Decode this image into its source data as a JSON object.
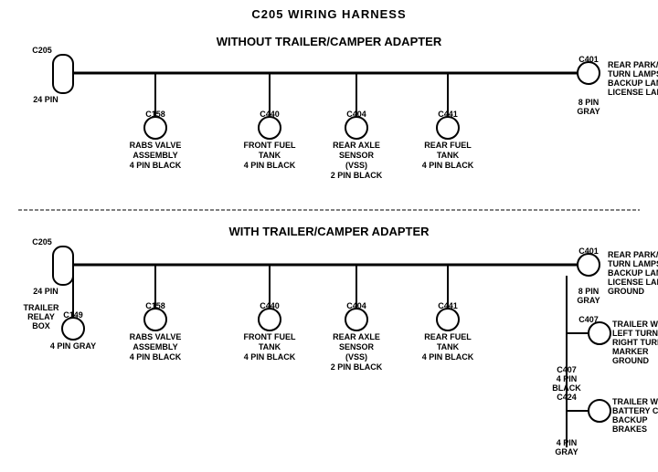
{
  "page": {
    "title": "C205 WIRING HARNESS"
  },
  "top_section": {
    "label": "WITHOUT  TRAILER/CAMPER  ADAPTER",
    "left_connector": {
      "id": "C205",
      "pins": "24 PIN",
      "shape": "rectangle"
    },
    "right_connector": {
      "id": "C401",
      "pins": "8 PIN",
      "color": "GRAY",
      "labels": [
        "REAR PARK/STOP",
        "TURN LAMPS",
        "BACKUP LAMPS",
        "LICENSE LAMPS"
      ]
    },
    "drop_connectors": [
      {
        "id": "C158",
        "label": "RABS VALVE\nASSEMBLY\n4 PIN BLACK"
      },
      {
        "id": "C440",
        "label": "FRONT FUEL\nTANK\n4 PIN BLACK"
      },
      {
        "id": "C404",
        "label": "REAR AXLE\nSENSOR\n(VSS)\n2 PIN BLACK"
      },
      {
        "id": "C441",
        "label": "REAR FUEL\nTANK\n4 PIN BLACK"
      }
    ]
  },
  "bottom_section": {
    "label": "WITH  TRAILER/CAMPER  ADAPTER",
    "left_connector": {
      "id": "C205",
      "pins": "24 PIN",
      "shape": "rectangle"
    },
    "trailer_relay": {
      "label": "TRAILER\nRELAY\nBOX",
      "connector_id": "C149",
      "pins": "4 PIN GRAY"
    },
    "right_connector": {
      "id": "C401",
      "pins": "8 PIN",
      "color": "GRAY",
      "labels": [
        "REAR PARK/STOP",
        "TURN LAMPS",
        "BACKUP LAMPS",
        "LICENSE LAMPS",
        "GROUND"
      ]
    },
    "right_branch_connectors": [
      {
        "id": "C407",
        "pins": "4 PIN",
        "color": "BLACK",
        "labels": [
          "TRAILER WIRES",
          "LEFT TURN",
          "RIGHT TURN",
          "MARKER",
          "GROUND"
        ]
      },
      {
        "id": "C424",
        "pins": "4 PIN",
        "color": "GRAY",
        "labels": [
          "TRAILER WIRES",
          "BATTERY CHARGE",
          "BACKUP",
          "BRAKES"
        ]
      }
    ],
    "drop_connectors": [
      {
        "id": "C158",
        "label": "RABS VALVE\nASSEMBLY\n4 PIN BLACK"
      },
      {
        "id": "C440",
        "label": "FRONT FUEL\nTANK\n4 PIN BLACK"
      },
      {
        "id": "C404",
        "label": "REAR AXLE\nSENSOR\n(VSS)\n2 PIN BLACK"
      },
      {
        "id": "C441",
        "label": "REAR FUEL\nTANK\n4 PIN BLACK"
      }
    ]
  }
}
